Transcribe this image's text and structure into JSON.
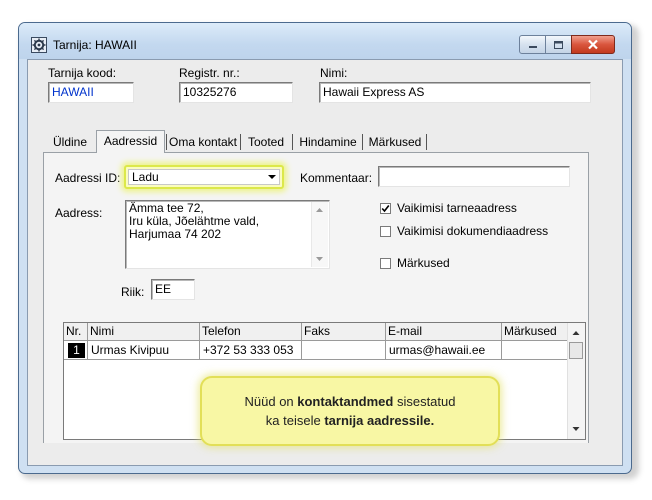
{
  "window": {
    "title": "Tarnija: HAWAII",
    "icon": "gear-icon"
  },
  "header": {
    "code_label": "Tarnija kood:",
    "code_value": "HAWAII",
    "reg_label": "Registr. nr.:",
    "reg_value": "10325276",
    "name_label": "Nimi:",
    "name_value": "Hawaii Express AS"
  },
  "tabs": [
    "Üldine",
    "Aadressid",
    "Oma kontakt",
    "Tooted",
    "Hindamine",
    "Märkused"
  ],
  "active_tab": "Aadressid",
  "form": {
    "address_id_label": "Aadressi ID:",
    "address_id_value": "Ladu",
    "comment_label": "Kommentaar:",
    "comment_value": "",
    "address_label": "Aadress:",
    "address_lines": [
      "Ämma tee 72,",
      "Iru küla, Jõelähtme vald,",
      "Harjumaa 74 202"
    ],
    "default_delivery_label": "Vaikimisi tarneaadress",
    "default_delivery_checked": true,
    "default_document_label": "Vaikimisi dokumendiaadress",
    "default_document_checked": false,
    "notes_label": "Märkused",
    "notes_checked": false,
    "country_label": "Riik:",
    "country_value": "EE"
  },
  "contacts": {
    "columns": [
      "Nr.",
      "Nimi",
      "Telefon",
      "Faks",
      "E-mail",
      "Märkused"
    ],
    "rows": [
      {
        "nr": "1",
        "name": "Urmas Kivipuu",
        "phone": "+372 53 333 053",
        "fax": "",
        "email": "urmas@hawaii.ee",
        "notes": ""
      }
    ]
  },
  "callout": {
    "part1": "Nüüd on ",
    "bold1": "kontaktandmed",
    "part2": " sisestatud",
    "part3": "ka teisele ",
    "bold2": "tarnija aadressile."
  },
  "colors": {
    "title_bg": "#c3d8ef",
    "callout_bg": "#f8f7a4",
    "highlight": "#dce84a",
    "code_text": "#0033cc"
  }
}
